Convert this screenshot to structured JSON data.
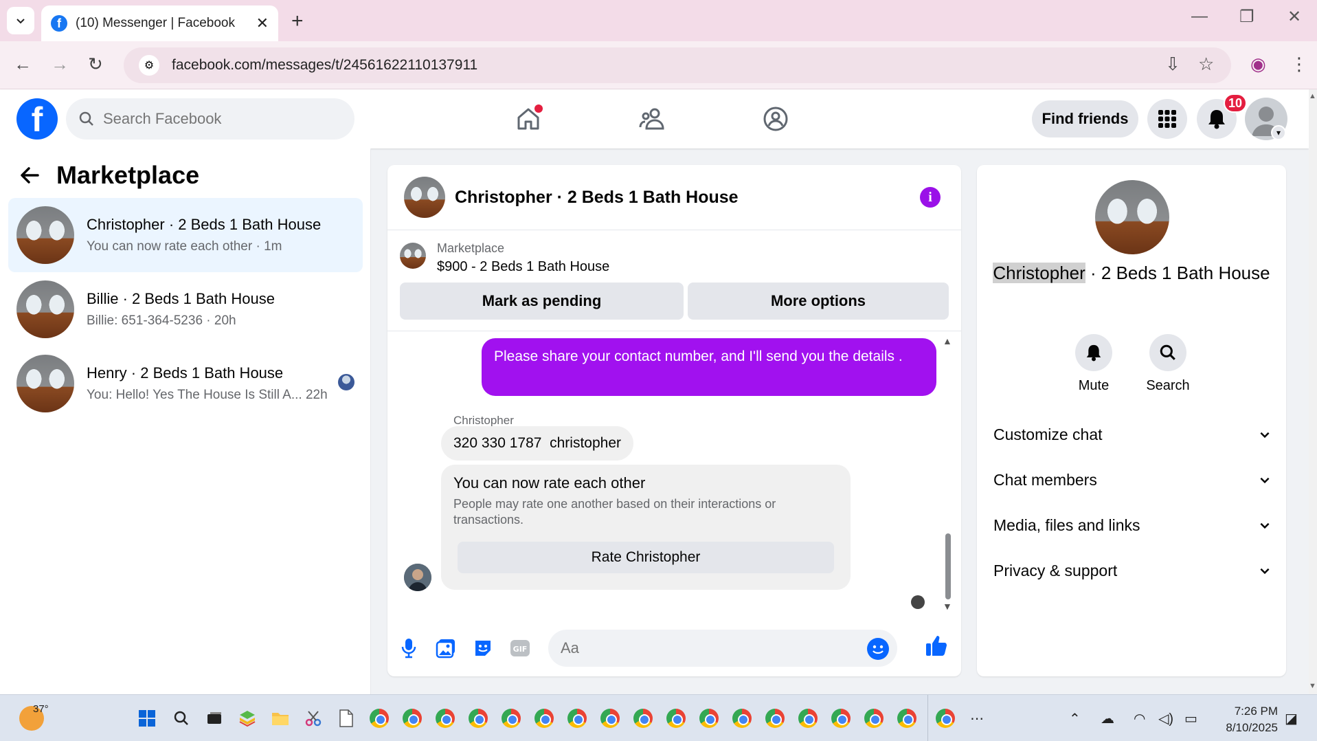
{
  "browser": {
    "tab_title": "(10) Messenger | Facebook",
    "url": "facebook.com/messages/t/24561622110137911"
  },
  "fb": {
    "search_placeholder": "Search Facebook",
    "find_friends": "Find friends",
    "notification_count": "10"
  },
  "sidebar": {
    "title": "Marketplace",
    "conversations": [
      {
        "name": "Christopher · 2 Beds 1 Bath House",
        "subtitle": "You can now rate each other · 1m"
      },
      {
        "name": "Billie · 2 Beds 1 Bath House",
        "subtitle": "Billie: 651-364-5236 · 20h"
      },
      {
        "name": "Henry · 2 Beds 1 Bath House",
        "subtitle": "You: Hello! Yes The House Is Still A... 22h"
      }
    ]
  },
  "chat": {
    "title": "Christopher · 2 Beds 1 Bath House",
    "marketplace_label": "Marketplace",
    "listing": "$900 - 2 Beds 1 Bath House",
    "mark_pending": "Mark as pending",
    "more_options": "More options",
    "outgoing_message": "Please share your contact number, and I'll send you the details .",
    "sender_name": "Christopher",
    "incoming_message": "320 330 1787  christopher",
    "rate_title": "You can now rate each other",
    "rate_desc": "People may rate one another based on their interactions or transactions.",
    "rate_button": "Rate Christopher",
    "composer_placeholder": "Aa"
  },
  "info": {
    "name_highlight": "Christopher",
    "name_rest": " · 2 Beds 1 Bath House",
    "mute": "Mute",
    "search": "Search",
    "sections": [
      "Customize chat",
      "Chat members",
      "Media, files and links",
      "Privacy & support"
    ]
  },
  "taskbar": {
    "temperature": "37°",
    "time": "7:26 PM",
    "date": "8/10/2025"
  },
  "colors": {
    "fb_blue": "#0866ff",
    "messenger_purple": "#a111ef",
    "notification_red": "#e41e3f"
  }
}
